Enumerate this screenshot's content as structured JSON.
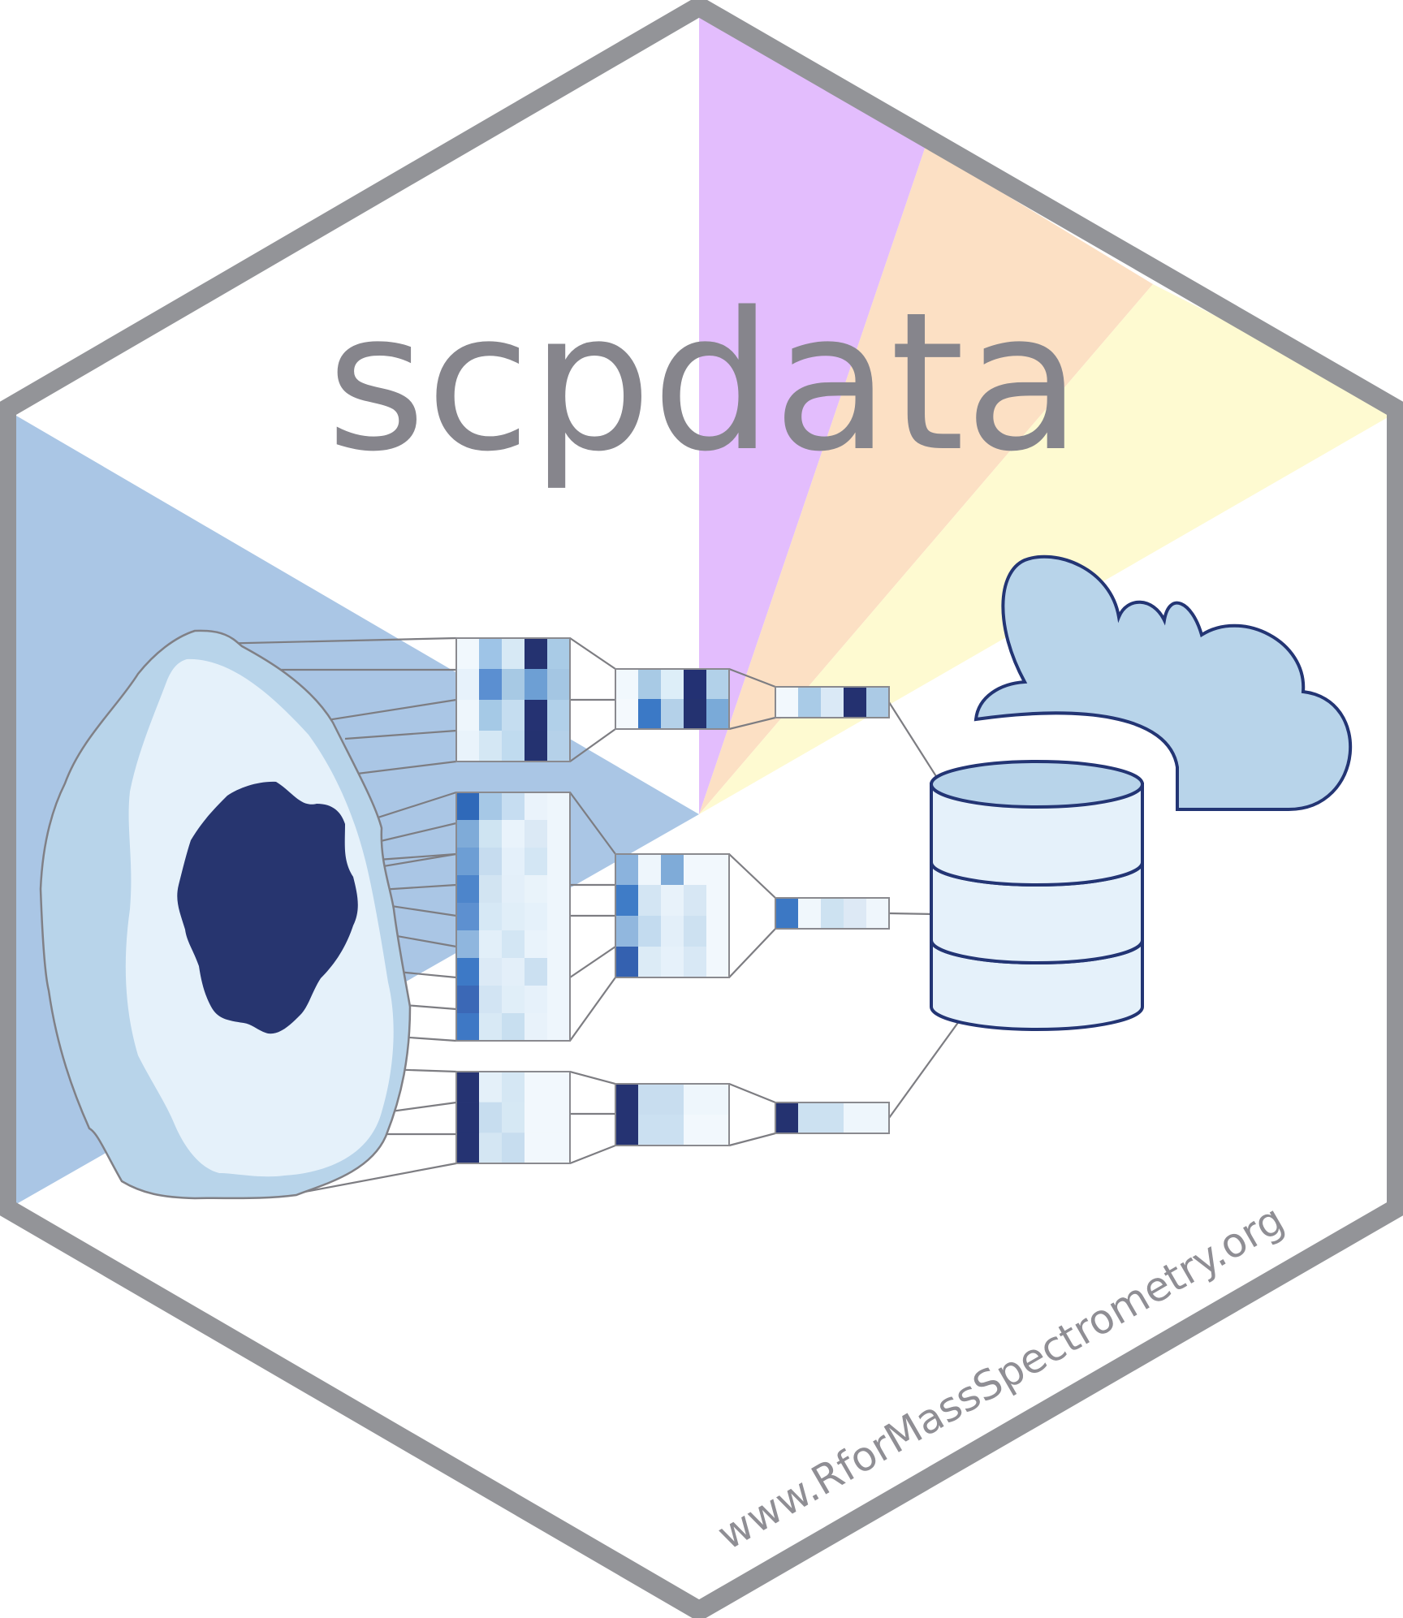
{
  "logo": {
    "title": "scpdata",
    "url": "www.RforMassSpectrometry.org"
  },
  "colors": {
    "frame": "#939498",
    "sector_purple": "#e3bdfd",
    "sector_peach": "#fce0c4",
    "sector_yellow": "#fefad1",
    "sector_blue": "#aac6e5",
    "cloud_fill": "#b8d4ea",
    "cylinder_top": "#b8d4ea",
    "cylinder_side": "#e5f1fa",
    "outline_navy": "#233574",
    "nucleus": "#27356f",
    "cell_outer": "#b8d4ea",
    "cell_inner": "#e5f1fa"
  },
  "icons": [
    "cell-icon",
    "heatmap-block-icon",
    "database-icon",
    "cloud-icon"
  ],
  "heatmaps": [
    {
      "name": "heatmap-top-1",
      "cells": [
        [
          "#f1f8fd",
          "#9ec4e7",
          "#d7e9f5",
          "#243270",
          "#a9cbe6"
        ],
        [
          "#e7f2fb",
          "#5b8fd1",
          "#a7c9e4",
          "#6d9fd4",
          "#a4c6e3"
        ],
        [
          "#eef6fc",
          "#a5c9e6",
          "#c5ddf0",
          "#253272",
          "#b1d0e9"
        ],
        [
          "#e9f3fb",
          "#d4e7f4",
          "#c0dbef",
          "#243270",
          "#b5d1e9"
        ]
      ]
    },
    {
      "name": "heatmap-top-2",
      "cells": [
        [
          "#f1f8fd",
          "#a8cae5",
          "#ddeef8",
          "#233173",
          "#b2d1e9"
        ],
        [
          "#f4f9fd",
          "#3b79c6",
          "#b4d1e9",
          "#243270",
          "#7aaad8"
        ]
      ]
    },
    {
      "name": "heatmap-top-3",
      "cells": [
        [
          "#f2f8fd",
          "#a9cbe7",
          "#dae9f6",
          "#243170",
          "#abcae5"
        ]
      ]
    },
    {
      "name": "heatmap-mid-1",
      "cells": [
        [
          "#2f69b9",
          "#a6c8e6",
          "#c6ddf1",
          "#eaf3fb",
          "#eef6fc"
        ],
        [
          "#7fabd8",
          "#cfe4f2",
          "#e9f3fb",
          "#dbe9f5",
          "#eef6fc"
        ],
        [
          "#6d9ed4",
          "#c6dcef",
          "#e4f0fa",
          "#d3e6f4",
          "#eef6fc"
        ],
        [
          "#4d85cb",
          "#d2e4f2",
          "#e3eff9",
          "#e9f3fa",
          "#eef6fc"
        ],
        [
          "#5d90d0",
          "#d6e8f5",
          "#e0eef8",
          "#e5f1fa",
          "#eef6fc"
        ],
        [
          "#8fb6de",
          "#e2eff9",
          "#d3e6f4",
          "#e9f3fb",
          "#eef6fc"
        ],
        [
          "#3d79c6",
          "#dceaf6",
          "#e3eff9",
          "#cbe0f1",
          "#eef6fc"
        ],
        [
          "#3b68b6",
          "#d2e4f3",
          "#e0eef8",
          "#e6f1fa",
          "#eef6fc"
        ],
        [
          "#3e78c5",
          "#d8e9f5",
          "#c8dff0",
          "#e8f2fa",
          "#eef6fc"
        ]
      ]
    },
    {
      "name": "heatmap-mid-2",
      "cells": [
        [
          "#8bb3dd",
          "#eef6fc",
          "#7fabd8",
          "#f2f8fd",
          "#f2f8fd"
        ],
        [
          "#3f7cc7",
          "#d3e5f3",
          "#e8f2fa",
          "#d7e7f4",
          "#f2f8fd"
        ],
        [
          "#91b7de",
          "#c3dbef",
          "#e3eff9",
          "#cde1f1",
          "#f2f8fd"
        ],
        [
          "#3461b0",
          "#dcebf6",
          "#e6f1fa",
          "#d8e8f5",
          "#f2f8fd"
        ]
      ]
    },
    {
      "name": "heatmap-mid-3",
      "cells": [
        [
          "#3c78c4",
          "#f0f7fc",
          "#cde2f1",
          "#dde9f5",
          "#eff6fc"
        ]
      ]
    },
    {
      "name": "heatmap-bot-1",
      "cells": [
        [
          "#253372",
          "#e4f0f9",
          "#d5e7f4",
          "#f2f8fd",
          "#f2f8fd"
        ],
        [
          "#253372",
          "#c7ddef",
          "#d6e8f4",
          "#f2f8fd",
          "#f2f8fd"
        ],
        [
          "#253372",
          "#d4e6f3",
          "#c7ddef",
          "#f2f8fd",
          "#f2f8fd"
        ]
      ]
    },
    {
      "name": "heatmap-bot-2",
      "cells": [
        [
          "#253372",
          "#c8ddef",
          "#c8ddef",
          "#eef6fc",
          "#eef6fc"
        ],
        [
          "#253372",
          "#cbe0f1",
          "#cbe0f1",
          "#f2f8fd",
          "#f2f8fd"
        ]
      ]
    },
    {
      "name": "heatmap-bot-3",
      "cells": [
        [
          "#243270",
          "#cce1f1",
          "#cce1f1",
          "#eef6fc",
          "#eef6fc"
        ]
      ]
    }
  ]
}
